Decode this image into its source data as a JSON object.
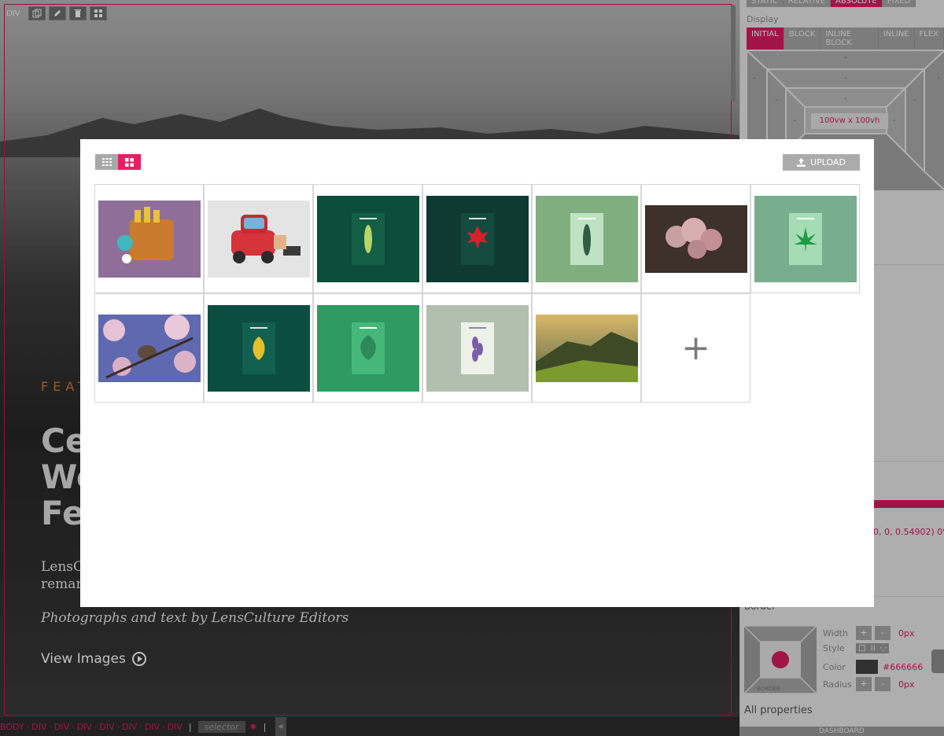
{
  "canvas": {
    "element_tag": "DIV",
    "section_label": "FEAT",
    "hero_title_lines": [
      "Ce",
      "Wo",
      "Fe"
    ],
    "hero_desc_lines": [
      "LensC",
      "remar"
    ],
    "byline": "Photographs and text by LensCulture Editors",
    "view_images": "View Images"
  },
  "breadcrumb": {
    "items": [
      "BODY",
      "DIV",
      "DIV",
      "DIV",
      "DIV",
      "DIV",
      "DIV",
      "DIV"
    ],
    "selector_placeholder": "selector",
    "collapse": "«"
  },
  "panel": {
    "position_options": [
      "STATIC",
      "RELATIVE",
      "ABSOLUTE",
      "FIXED"
    ],
    "position_active": "ABSOLUTE",
    "display_label": "Display",
    "display_options": [
      "INITIAL",
      "BLOCK",
      "INLINE BLOCK",
      "INLINE",
      "FLEX"
    ],
    "display_active": "INITIAL",
    "box_dims": "100vw x 100vh",
    "box_dash": "-",
    "gradient_text": "0, 0, 0.54902) 0%,",
    "border_title": "Border",
    "border_box_label": "BORDER",
    "border_width_label": "Width",
    "border_width_value": "0px",
    "border_style_label": "Style",
    "border_color_label": "Color",
    "border_color_value": "#666666",
    "border_radius_label": "Radius",
    "border_radius_value": "0px",
    "plus": "+",
    "minus": "-",
    "all_properties": "All properties",
    "dashboard": "DASHBOARD"
  },
  "modal": {
    "upload_label": "UPLOAD",
    "add_label": "+",
    "images": [
      {
        "name": "orange-machine-figurine",
        "bg": "#8a6a93"
      },
      {
        "name": "red-cartoon-car",
        "bg": "#e6e6e6"
      },
      {
        "name": "green-leaf-poster-dark",
        "bg": "#0b4f3a"
      },
      {
        "name": "red-maple-poster",
        "bg": "#0d3b32"
      },
      {
        "name": "fern-poster-light",
        "bg": "#7fae7c"
      },
      {
        "name": "pink-hyacinth-flowers",
        "bg": "#3d2f2a"
      },
      {
        "name": "cannabis-leaf-poster",
        "bg": "#79b08f"
      },
      {
        "name": "bird-cherry-blossom",
        "bg": "#6a6aa0"
      },
      {
        "name": "yellow-leaf-poster",
        "bg": "#0b4d40"
      },
      {
        "name": "green-leaf-poster-bright",
        "bg": "#2f9c63"
      },
      {
        "name": "lavender-leaf-poster",
        "bg": "#b7c3b2"
      },
      {
        "name": "mountain-landscape",
        "bg": "#6b6a2f"
      }
    ]
  },
  "colors": {
    "accent": "#e91e63",
    "selection": "#d81b60",
    "panel_bg": "#e9e9e9"
  }
}
